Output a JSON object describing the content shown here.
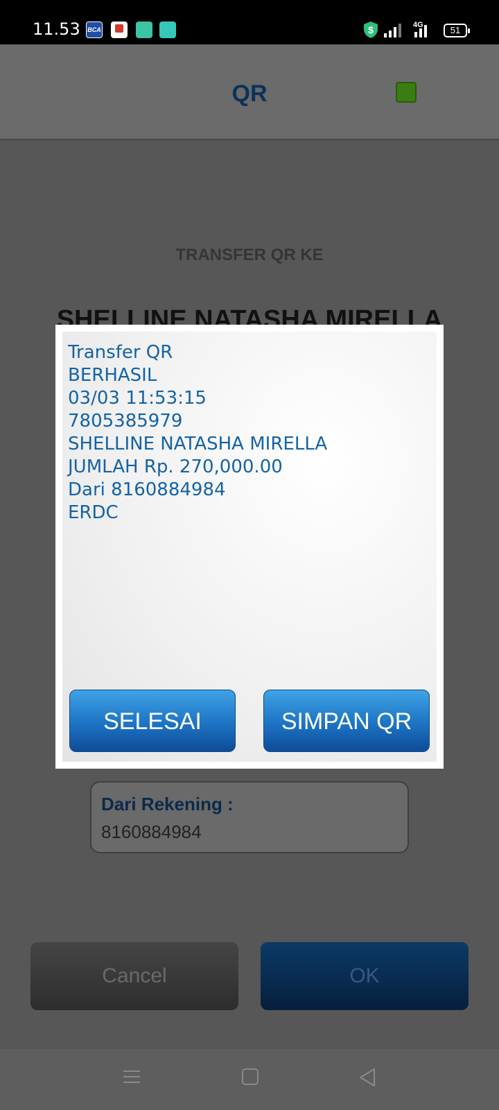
{
  "status_bar": {
    "time": "11.53",
    "network": "4G",
    "battery": "51",
    "app_icons": [
      "bca-mobile-icon",
      "red-app-icon",
      "teal-app-icon",
      "teal-app-icon-2"
    ]
  },
  "header": {
    "title": "QR",
    "status_color": "#3a7d10"
  },
  "background": {
    "transfer_label": "TRANSFER QR KE",
    "recipient_name": "SHELLINE NATASHA MIRELLA",
    "from_account_label": "Dari Rekening :",
    "from_account_value": "8160884984",
    "cancel_label": "Cancel",
    "ok_label": "OK"
  },
  "dialog": {
    "lines": [
      "Transfer QR",
      "BERHASIL",
      "03/03 11:53:15",
      "7805385979",
      "SHELLINE NATASHA MIRELLA",
      "JUMLAH Rp. 270,000.00",
      "Dari 8160884984",
      "ERDC"
    ],
    "selesai_label": "SELESAI",
    "simpan_label": "SIMPAN QR"
  },
  "nav": {
    "icons": [
      "menu-icon",
      "home-icon",
      "back-icon"
    ]
  },
  "colors": {
    "accent_blue": "#1463a5",
    "header_title": "#0b3358"
  }
}
